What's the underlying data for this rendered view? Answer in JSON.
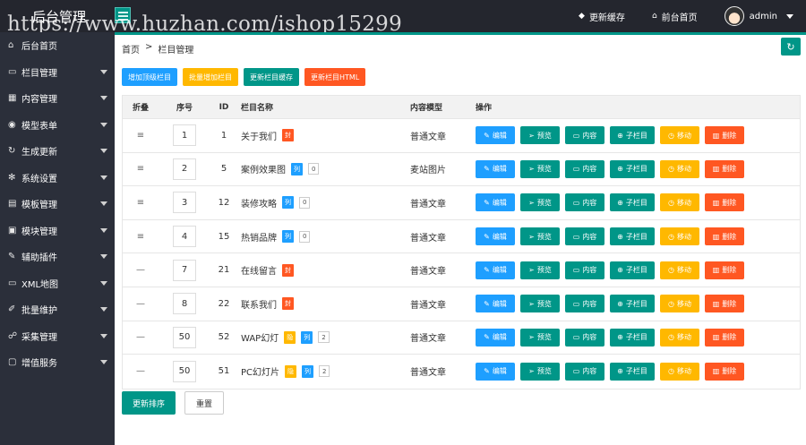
{
  "app": {
    "title": "后台管理",
    "watermark": "https://www.huzhan.com/ishop15299"
  },
  "header": {
    "refresh_cache": "更新缓存",
    "frontend": "前台首页",
    "username": "admin"
  },
  "sidebar": {
    "items": [
      {
        "label": "后台首页",
        "icon": "home-icon",
        "glyph": "⌂",
        "has_arrow": false
      },
      {
        "label": "栏目管理",
        "icon": "monitor-icon",
        "glyph": "▭",
        "has_arrow": true
      },
      {
        "label": "内容管理",
        "icon": "grid-icon",
        "glyph": "▦",
        "has_arrow": true
      },
      {
        "label": "模型表单",
        "icon": "compass-icon",
        "glyph": "◉",
        "has_arrow": true
      },
      {
        "label": "生成更新",
        "icon": "refresh-icon",
        "glyph": "↻",
        "has_arrow": true
      },
      {
        "label": "系统设置",
        "icon": "gear-icon",
        "glyph": "✻",
        "has_arrow": true
      },
      {
        "label": "模板管理",
        "icon": "template-icon",
        "glyph": "▤",
        "has_arrow": true
      },
      {
        "label": "模块管理",
        "icon": "module-icon",
        "glyph": "▣",
        "has_arrow": true
      },
      {
        "label": "辅助插件",
        "icon": "plugin-icon",
        "glyph": "✎",
        "has_arrow": true
      },
      {
        "label": "XML地图",
        "icon": "monitor-icon",
        "glyph": "▭",
        "has_arrow": true
      },
      {
        "label": "批量维护",
        "icon": "edit-icon",
        "glyph": "✐",
        "has_arrow": true
      },
      {
        "label": "采集管理",
        "icon": "collect-icon",
        "glyph": "☍",
        "has_arrow": true
      },
      {
        "label": "增值服务",
        "icon": "service-icon",
        "glyph": "▢",
        "has_arrow": true
      }
    ]
  },
  "breadcrumb": {
    "home": "首页",
    "sep": ">",
    "current": "栏目管理"
  },
  "toolbar": {
    "add_top": "增加顶级栏目",
    "batch_add": "批量增加栏目",
    "update_cache": "更新栏目缓存",
    "update_html": "更新栏目HTML"
  },
  "table": {
    "headers": {
      "fold": "折叠",
      "sort": "序号",
      "id": "ID",
      "name": "栏目名称",
      "model": "内容模型",
      "ops": "操作"
    },
    "op_labels": {
      "edit": "编辑",
      "preview": "预览",
      "content": "内容",
      "sub": "子栏目",
      "move": "移动",
      "delete": "删除"
    },
    "rows": [
      {
        "fold": "≡",
        "sort": "1",
        "id": "1",
        "name": "关于我们",
        "tags": [
          {
            "text": "封",
            "color": "red"
          }
        ],
        "count": "",
        "model": "普通文章"
      },
      {
        "fold": "≡",
        "sort": "2",
        "id": "5",
        "name": "案例效果图",
        "tags": [
          {
            "text": "列",
            "color": "blue"
          }
        ],
        "count": "0",
        "model": "麦站图片"
      },
      {
        "fold": "≡",
        "sort": "3",
        "id": "12",
        "name": "装修攻略",
        "tags": [
          {
            "text": "列",
            "color": "blue"
          }
        ],
        "count": "0",
        "model": "普通文章"
      },
      {
        "fold": "≡",
        "sort": "4",
        "id": "15",
        "name": "热销品牌",
        "tags": [
          {
            "text": "列",
            "color": "blue"
          }
        ],
        "count": "0",
        "model": "普通文章"
      },
      {
        "fold": "—",
        "sort": "7",
        "id": "21",
        "name": "在线留言",
        "tags": [
          {
            "text": "封",
            "color": "red"
          }
        ],
        "count": "",
        "model": "普通文章"
      },
      {
        "fold": "—",
        "sort": "8",
        "id": "22",
        "name": "联系我们",
        "tags": [
          {
            "text": "封",
            "color": "red"
          }
        ],
        "count": "",
        "model": "普通文章"
      },
      {
        "fold": "—",
        "sort": "50",
        "id": "52",
        "name": "WAP幻灯",
        "tags": [
          {
            "text": "隐",
            "color": "yellow"
          },
          {
            "text": "列",
            "color": "blue"
          }
        ],
        "count": "2",
        "model": "普通文章"
      },
      {
        "fold": "—",
        "sort": "50",
        "id": "51",
        "name": "PC幻灯片",
        "tags": [
          {
            "text": "隐",
            "color": "yellow"
          },
          {
            "text": "列",
            "color": "blue"
          }
        ],
        "count": "2",
        "model": "普通文章"
      }
    ]
  },
  "footer": {
    "update_sort": "更新排序",
    "reset": "重置"
  },
  "colors": {
    "primary": "#009688",
    "blue": "#1e9fff",
    "yellow": "#ffb800",
    "red": "#ff5722",
    "sidebar": "#2b2f3a",
    "topbar": "#24262e"
  }
}
